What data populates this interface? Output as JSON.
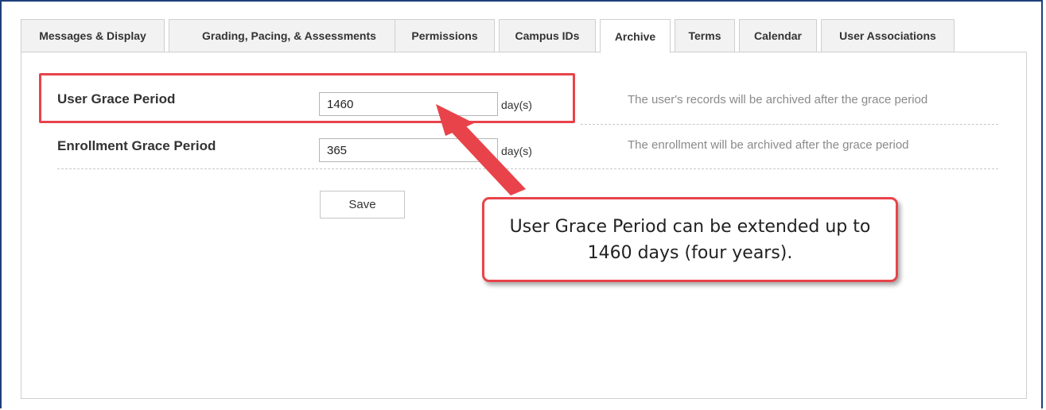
{
  "tabs": [
    {
      "label": "Messages & Display",
      "active": false
    },
    {
      "label": "Grading, Pacing, & Assessments",
      "active": false
    },
    {
      "label": "Permissions",
      "active": false
    },
    {
      "label": "Campus IDs",
      "active": false
    },
    {
      "label": "Archive",
      "active": true
    },
    {
      "label": "Terms",
      "active": false
    },
    {
      "label": "Calendar",
      "active": false
    },
    {
      "label": "User Associations",
      "active": false
    }
  ],
  "archive": {
    "user_grace": {
      "label": "User Grace Period",
      "value": "1460",
      "unit": "day(s)",
      "help": "The user's records will be archived after the grace period"
    },
    "enrollment_grace": {
      "label": "Enrollment Grace Period",
      "value": "365",
      "unit": "day(s)",
      "help": "The enrollment will be archived after the grace period"
    },
    "save_label": "Save"
  },
  "annotation": {
    "callout_text": "User Grace Period can be extended up to 1460 days (four years).",
    "color": "#e8434a"
  }
}
